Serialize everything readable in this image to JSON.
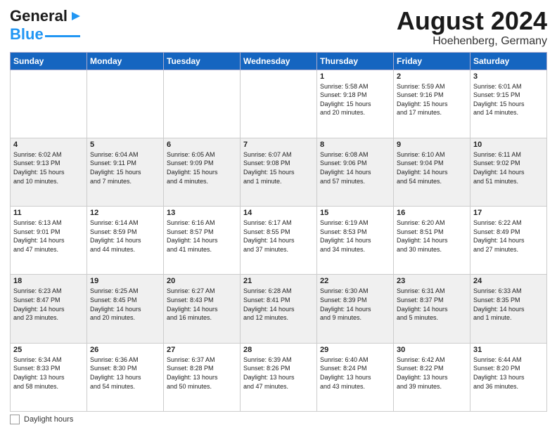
{
  "header": {
    "logo_line1": "General",
    "logo_line2": "Blue",
    "title": "August 2024",
    "subtitle": "Hoehenberg, Germany"
  },
  "days_of_week": [
    "Sunday",
    "Monday",
    "Tuesday",
    "Wednesday",
    "Thursday",
    "Friday",
    "Saturday"
  ],
  "footer_label": "Daylight hours",
  "weeks": [
    [
      {
        "num": "",
        "info": ""
      },
      {
        "num": "",
        "info": ""
      },
      {
        "num": "",
        "info": ""
      },
      {
        "num": "",
        "info": ""
      },
      {
        "num": "1",
        "info": "Sunrise: 5:58 AM\nSunset: 9:18 PM\nDaylight: 15 hours\nand 20 minutes."
      },
      {
        "num": "2",
        "info": "Sunrise: 5:59 AM\nSunset: 9:16 PM\nDaylight: 15 hours\nand 17 minutes."
      },
      {
        "num": "3",
        "info": "Sunrise: 6:01 AM\nSunset: 9:15 PM\nDaylight: 15 hours\nand 14 minutes."
      }
    ],
    [
      {
        "num": "4",
        "info": "Sunrise: 6:02 AM\nSunset: 9:13 PM\nDaylight: 15 hours\nand 10 minutes."
      },
      {
        "num": "5",
        "info": "Sunrise: 6:04 AM\nSunset: 9:11 PM\nDaylight: 15 hours\nand 7 minutes."
      },
      {
        "num": "6",
        "info": "Sunrise: 6:05 AM\nSunset: 9:09 PM\nDaylight: 15 hours\nand 4 minutes."
      },
      {
        "num": "7",
        "info": "Sunrise: 6:07 AM\nSunset: 9:08 PM\nDaylight: 15 hours\nand 1 minute."
      },
      {
        "num": "8",
        "info": "Sunrise: 6:08 AM\nSunset: 9:06 PM\nDaylight: 14 hours\nand 57 minutes."
      },
      {
        "num": "9",
        "info": "Sunrise: 6:10 AM\nSunset: 9:04 PM\nDaylight: 14 hours\nand 54 minutes."
      },
      {
        "num": "10",
        "info": "Sunrise: 6:11 AM\nSunset: 9:02 PM\nDaylight: 14 hours\nand 51 minutes."
      }
    ],
    [
      {
        "num": "11",
        "info": "Sunrise: 6:13 AM\nSunset: 9:01 PM\nDaylight: 14 hours\nand 47 minutes."
      },
      {
        "num": "12",
        "info": "Sunrise: 6:14 AM\nSunset: 8:59 PM\nDaylight: 14 hours\nand 44 minutes."
      },
      {
        "num": "13",
        "info": "Sunrise: 6:16 AM\nSunset: 8:57 PM\nDaylight: 14 hours\nand 41 minutes."
      },
      {
        "num": "14",
        "info": "Sunrise: 6:17 AM\nSunset: 8:55 PM\nDaylight: 14 hours\nand 37 minutes."
      },
      {
        "num": "15",
        "info": "Sunrise: 6:19 AM\nSunset: 8:53 PM\nDaylight: 14 hours\nand 34 minutes."
      },
      {
        "num": "16",
        "info": "Sunrise: 6:20 AM\nSunset: 8:51 PM\nDaylight: 14 hours\nand 30 minutes."
      },
      {
        "num": "17",
        "info": "Sunrise: 6:22 AM\nSunset: 8:49 PM\nDaylight: 14 hours\nand 27 minutes."
      }
    ],
    [
      {
        "num": "18",
        "info": "Sunrise: 6:23 AM\nSunset: 8:47 PM\nDaylight: 14 hours\nand 23 minutes."
      },
      {
        "num": "19",
        "info": "Sunrise: 6:25 AM\nSunset: 8:45 PM\nDaylight: 14 hours\nand 20 minutes."
      },
      {
        "num": "20",
        "info": "Sunrise: 6:27 AM\nSunset: 8:43 PM\nDaylight: 14 hours\nand 16 minutes."
      },
      {
        "num": "21",
        "info": "Sunrise: 6:28 AM\nSunset: 8:41 PM\nDaylight: 14 hours\nand 12 minutes."
      },
      {
        "num": "22",
        "info": "Sunrise: 6:30 AM\nSunset: 8:39 PM\nDaylight: 14 hours\nand 9 minutes."
      },
      {
        "num": "23",
        "info": "Sunrise: 6:31 AM\nSunset: 8:37 PM\nDaylight: 14 hours\nand 5 minutes."
      },
      {
        "num": "24",
        "info": "Sunrise: 6:33 AM\nSunset: 8:35 PM\nDaylight: 14 hours\nand 1 minute."
      }
    ],
    [
      {
        "num": "25",
        "info": "Sunrise: 6:34 AM\nSunset: 8:33 PM\nDaylight: 13 hours\nand 58 minutes."
      },
      {
        "num": "26",
        "info": "Sunrise: 6:36 AM\nSunset: 8:30 PM\nDaylight: 13 hours\nand 54 minutes."
      },
      {
        "num": "27",
        "info": "Sunrise: 6:37 AM\nSunset: 8:28 PM\nDaylight: 13 hours\nand 50 minutes."
      },
      {
        "num": "28",
        "info": "Sunrise: 6:39 AM\nSunset: 8:26 PM\nDaylight: 13 hours\nand 47 minutes."
      },
      {
        "num": "29",
        "info": "Sunrise: 6:40 AM\nSunset: 8:24 PM\nDaylight: 13 hours\nand 43 minutes."
      },
      {
        "num": "30",
        "info": "Sunrise: 6:42 AM\nSunset: 8:22 PM\nDaylight: 13 hours\nand 39 minutes."
      },
      {
        "num": "31",
        "info": "Sunrise: 6:44 AM\nSunset: 8:20 PM\nDaylight: 13 hours\nand 36 minutes."
      }
    ]
  ]
}
